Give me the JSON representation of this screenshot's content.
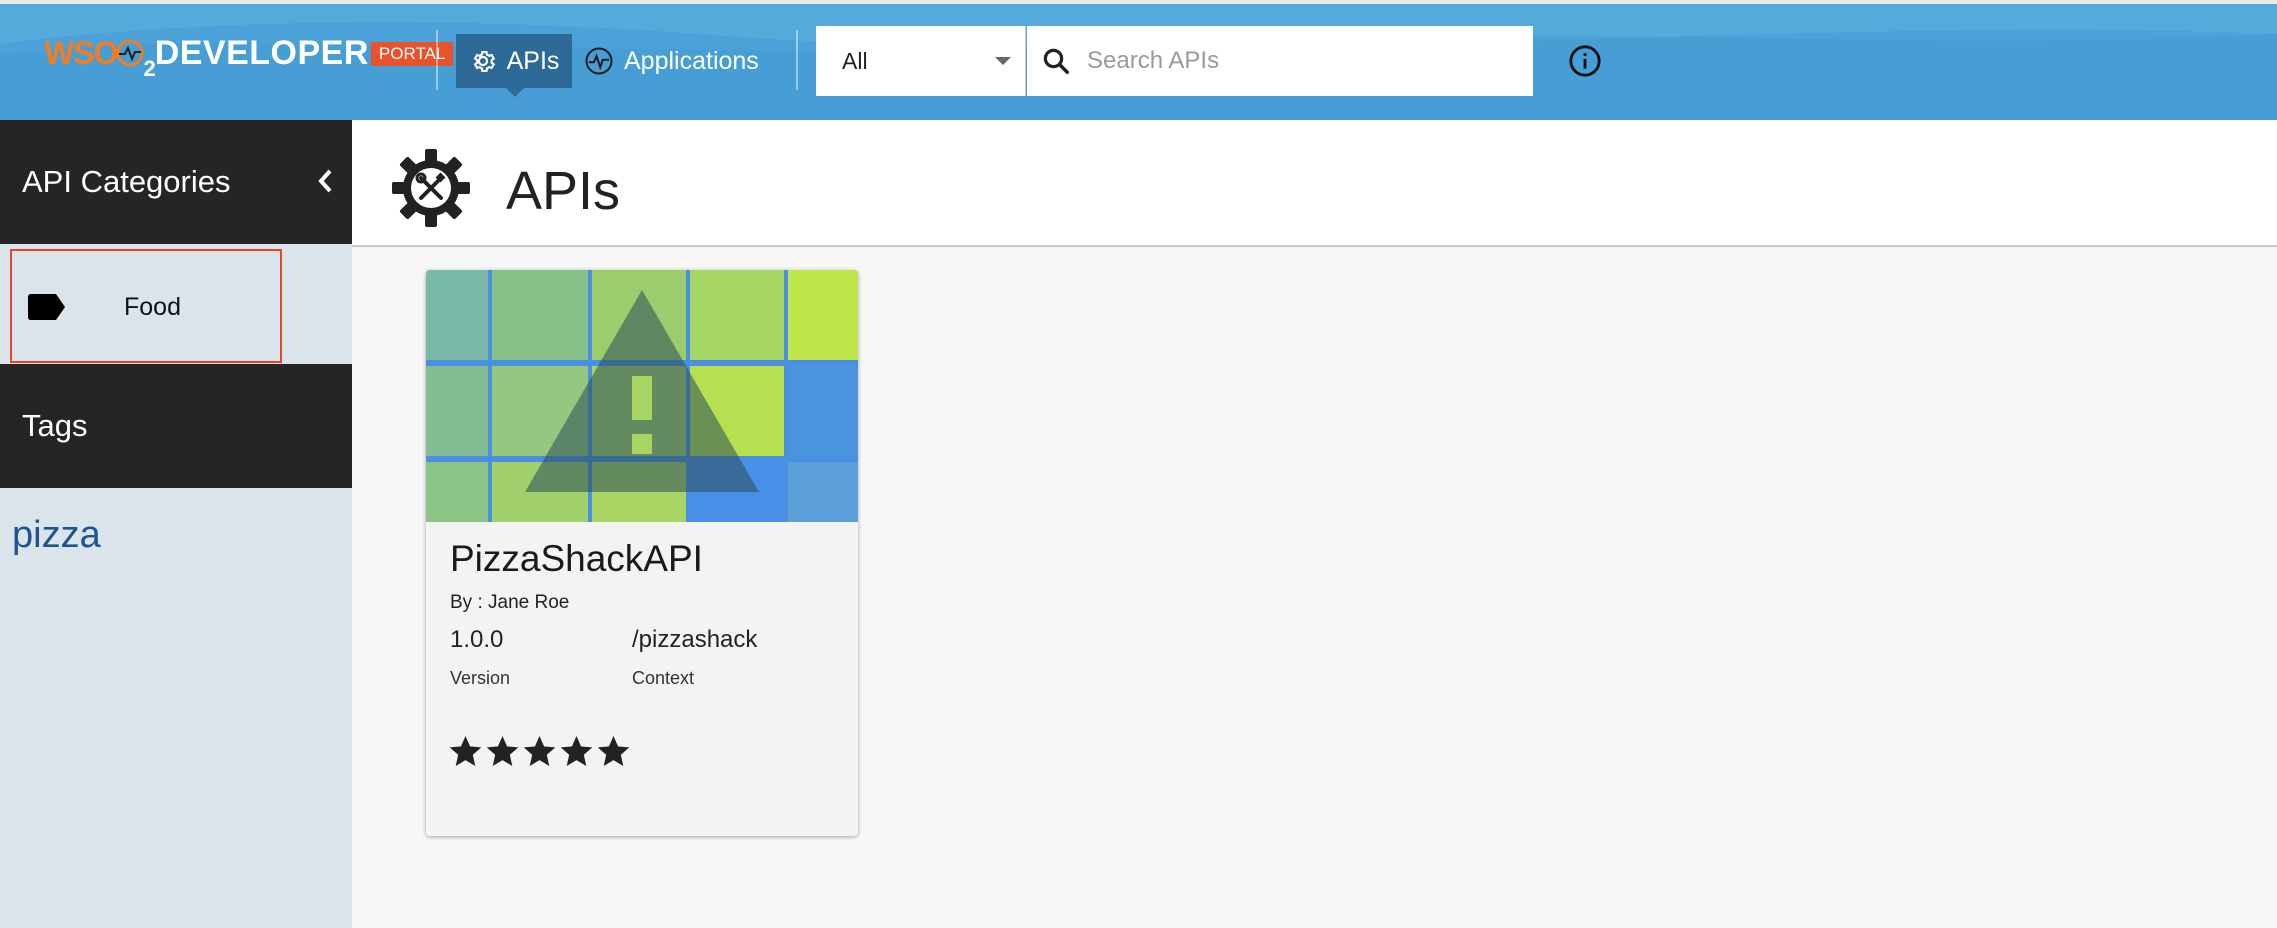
{
  "header": {
    "logo": {
      "brand": "WSO",
      "subscript": "2",
      "name": "DEVELOPER",
      "badge": "PORTAL"
    },
    "nav": [
      {
        "label": "APIs",
        "icon": "gear-icon",
        "active": true
      },
      {
        "label": "Applications",
        "icon": "pulse-circle-icon",
        "active": false
      }
    ],
    "search": {
      "scope": "All",
      "placeholder": "Search APIs",
      "value": ""
    },
    "info_icon": "info-circle-icon"
  },
  "sidebar": {
    "categories_title": "API Categories",
    "categories": [
      {
        "label": "Food",
        "icon": "tag-icon"
      }
    ],
    "tags_title": "Tags",
    "tags": [
      "pizza"
    ]
  },
  "main": {
    "title": "APIs",
    "title_icon": "gear-wrench-icon",
    "cards": [
      {
        "name": "PizzaShackAPI",
        "by": "By : Jane Roe",
        "version": "1.0.0",
        "version_label": "Version",
        "context": "/pizzashack",
        "context_label": "Context",
        "rating": 5,
        "thumbnail_icon": "warning-triangle-icon"
      }
    ]
  },
  "colors": {
    "header": "#4aa2d8",
    "nav_active": "#2e6a97",
    "sidebar_dark": "#252525",
    "sidebar_light": "#dbe4ea",
    "highlight_border": "#e0492e",
    "tag_link": "#1e5591",
    "logo_orange": "#f47b20",
    "portal_badge": "#e8532e"
  }
}
